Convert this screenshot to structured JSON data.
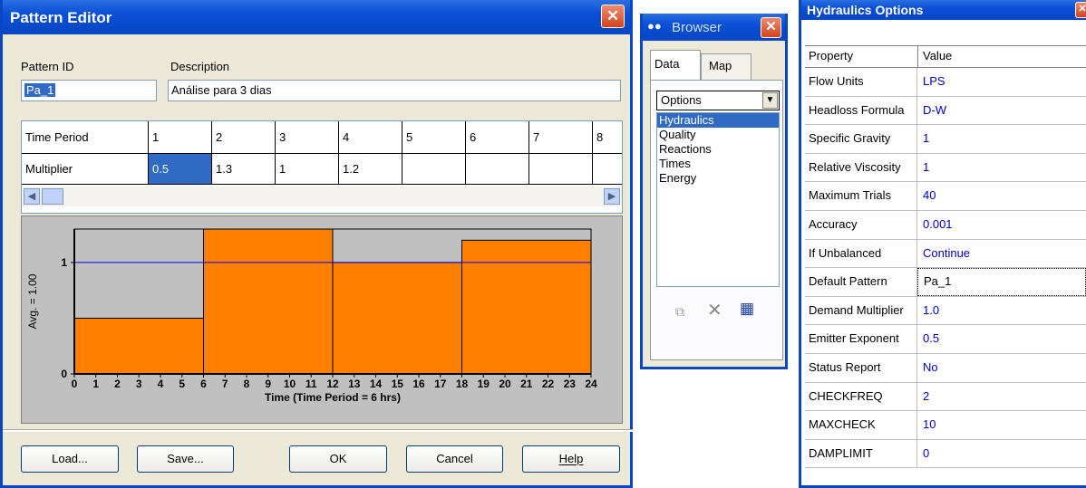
{
  "pattern_editor": {
    "title": "Pattern Editor",
    "pattern_id_label": "Pattern ID",
    "pattern_id_value": "Pa_1",
    "description_label": "Description",
    "description_value": "Análise para 3 dias",
    "grid_header_label": "Time Period",
    "grid_row_label": "Multiplier",
    "periods": [
      "1",
      "2",
      "3",
      "4",
      "5",
      "6",
      "7",
      "8"
    ],
    "multipliers": [
      "0.5",
      "1.3",
      "1",
      "1.2",
      "",
      "",
      "",
      ""
    ],
    "buttons": {
      "load": "Load...",
      "save": "Save...",
      "ok": "OK",
      "cancel": "Cancel",
      "help": "Help"
    }
  },
  "chart_data": {
    "type": "bar",
    "xlabel": "Time (Time Period = 6 hrs)",
    "ylabel": "Avg. = 1.00",
    "x_ticks": [
      "0",
      "1",
      "2",
      "3",
      "4",
      "5",
      "6",
      "7",
      "8",
      "9",
      "10",
      "11",
      "12",
      "13",
      "14",
      "15",
      "16",
      "17",
      "18",
      "19",
      "20",
      "21",
      "22",
      "23",
      "24"
    ],
    "y_ticks": [
      "0",
      "1"
    ],
    "ylim": [
      0,
      1.3
    ],
    "xlim": [
      0,
      24
    ],
    "series": [
      {
        "periods": [
          [
            0,
            6,
            0.5
          ],
          [
            6,
            12,
            1.3
          ],
          [
            12,
            18,
            1.0
          ],
          [
            18,
            24,
            1.2
          ]
        ]
      }
    ],
    "average": 1.0,
    "bar_color": "#ff8000",
    "bg_color": "#c0c0c0",
    "avg_color": "#0000ff"
  },
  "browser": {
    "title": "Browser",
    "tabs": [
      "Data",
      "Map"
    ],
    "dropdown_value": "Options",
    "items": [
      "Hydraulics",
      "Quality",
      "Reactions",
      "Times",
      "Energy"
    ]
  },
  "hydraulics": {
    "title": "Hydraulics Options",
    "header": {
      "property": "Property",
      "value": "Value"
    },
    "rows": [
      {
        "property": "Flow Units",
        "value": "LPS"
      },
      {
        "property": "Headloss Formula",
        "value": "D-W"
      },
      {
        "property": "Specific Gravity",
        "value": "1"
      },
      {
        "property": "Relative Viscosity",
        "value": "1"
      },
      {
        "property": "Maximum Trials",
        "value": "40"
      },
      {
        "property": "Accuracy",
        "value": "0.001"
      },
      {
        "property": "If Unbalanced",
        "value": "Continue"
      },
      {
        "property": "Default Pattern",
        "value": "Pa_1"
      },
      {
        "property": "Demand Multiplier",
        "value": "1.0"
      },
      {
        "property": "Emitter Exponent",
        "value": "0.5"
      },
      {
        "property": "Status Report",
        "value": "No"
      },
      {
        "property": "CHECKFREQ",
        "value": "2"
      },
      {
        "property": "MAXCHECK",
        "value": "10"
      },
      {
        "property": "DAMPLIMIT",
        "value": "0"
      }
    ]
  }
}
